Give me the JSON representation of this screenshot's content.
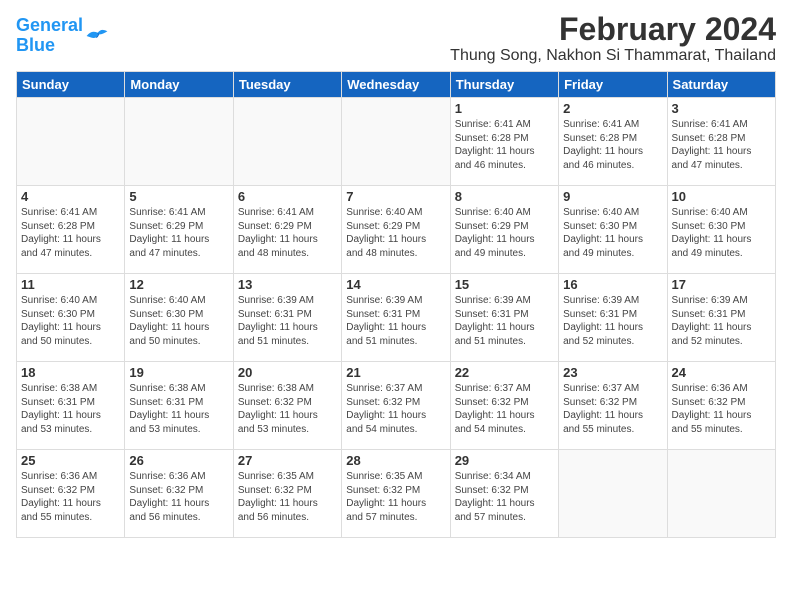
{
  "logo": {
    "line1": "General",
    "line2": "Blue"
  },
  "title": "February 2024",
  "subtitle": "Thung Song, Nakhon Si Thammarat, Thailand",
  "headers": [
    "Sunday",
    "Monday",
    "Tuesday",
    "Wednesday",
    "Thursday",
    "Friday",
    "Saturday"
  ],
  "weeks": [
    [
      {
        "day": "",
        "info": ""
      },
      {
        "day": "",
        "info": ""
      },
      {
        "day": "",
        "info": ""
      },
      {
        "day": "",
        "info": ""
      },
      {
        "day": "1",
        "info": "Sunrise: 6:41 AM\nSunset: 6:28 PM\nDaylight: 11 hours\nand 46 minutes."
      },
      {
        "day": "2",
        "info": "Sunrise: 6:41 AM\nSunset: 6:28 PM\nDaylight: 11 hours\nand 46 minutes."
      },
      {
        "day": "3",
        "info": "Sunrise: 6:41 AM\nSunset: 6:28 PM\nDaylight: 11 hours\nand 47 minutes."
      }
    ],
    [
      {
        "day": "4",
        "info": "Sunrise: 6:41 AM\nSunset: 6:28 PM\nDaylight: 11 hours\nand 47 minutes."
      },
      {
        "day": "5",
        "info": "Sunrise: 6:41 AM\nSunset: 6:29 PM\nDaylight: 11 hours\nand 47 minutes."
      },
      {
        "day": "6",
        "info": "Sunrise: 6:41 AM\nSunset: 6:29 PM\nDaylight: 11 hours\nand 48 minutes."
      },
      {
        "day": "7",
        "info": "Sunrise: 6:40 AM\nSunset: 6:29 PM\nDaylight: 11 hours\nand 48 minutes."
      },
      {
        "day": "8",
        "info": "Sunrise: 6:40 AM\nSunset: 6:29 PM\nDaylight: 11 hours\nand 49 minutes."
      },
      {
        "day": "9",
        "info": "Sunrise: 6:40 AM\nSunset: 6:30 PM\nDaylight: 11 hours\nand 49 minutes."
      },
      {
        "day": "10",
        "info": "Sunrise: 6:40 AM\nSunset: 6:30 PM\nDaylight: 11 hours\nand 49 minutes."
      }
    ],
    [
      {
        "day": "11",
        "info": "Sunrise: 6:40 AM\nSunset: 6:30 PM\nDaylight: 11 hours\nand 50 minutes."
      },
      {
        "day": "12",
        "info": "Sunrise: 6:40 AM\nSunset: 6:30 PM\nDaylight: 11 hours\nand 50 minutes."
      },
      {
        "day": "13",
        "info": "Sunrise: 6:39 AM\nSunset: 6:31 PM\nDaylight: 11 hours\nand 51 minutes."
      },
      {
        "day": "14",
        "info": "Sunrise: 6:39 AM\nSunset: 6:31 PM\nDaylight: 11 hours\nand 51 minutes."
      },
      {
        "day": "15",
        "info": "Sunrise: 6:39 AM\nSunset: 6:31 PM\nDaylight: 11 hours\nand 51 minutes."
      },
      {
        "day": "16",
        "info": "Sunrise: 6:39 AM\nSunset: 6:31 PM\nDaylight: 11 hours\nand 52 minutes."
      },
      {
        "day": "17",
        "info": "Sunrise: 6:39 AM\nSunset: 6:31 PM\nDaylight: 11 hours\nand 52 minutes."
      }
    ],
    [
      {
        "day": "18",
        "info": "Sunrise: 6:38 AM\nSunset: 6:31 PM\nDaylight: 11 hours\nand 53 minutes."
      },
      {
        "day": "19",
        "info": "Sunrise: 6:38 AM\nSunset: 6:31 PM\nDaylight: 11 hours\nand 53 minutes."
      },
      {
        "day": "20",
        "info": "Sunrise: 6:38 AM\nSunset: 6:32 PM\nDaylight: 11 hours\nand 53 minutes."
      },
      {
        "day": "21",
        "info": "Sunrise: 6:37 AM\nSunset: 6:32 PM\nDaylight: 11 hours\nand 54 minutes."
      },
      {
        "day": "22",
        "info": "Sunrise: 6:37 AM\nSunset: 6:32 PM\nDaylight: 11 hours\nand 54 minutes."
      },
      {
        "day": "23",
        "info": "Sunrise: 6:37 AM\nSunset: 6:32 PM\nDaylight: 11 hours\nand 55 minutes."
      },
      {
        "day": "24",
        "info": "Sunrise: 6:36 AM\nSunset: 6:32 PM\nDaylight: 11 hours\nand 55 minutes."
      }
    ],
    [
      {
        "day": "25",
        "info": "Sunrise: 6:36 AM\nSunset: 6:32 PM\nDaylight: 11 hours\nand 55 minutes."
      },
      {
        "day": "26",
        "info": "Sunrise: 6:36 AM\nSunset: 6:32 PM\nDaylight: 11 hours\nand 56 minutes."
      },
      {
        "day": "27",
        "info": "Sunrise: 6:35 AM\nSunset: 6:32 PM\nDaylight: 11 hours\nand 56 minutes."
      },
      {
        "day": "28",
        "info": "Sunrise: 6:35 AM\nSunset: 6:32 PM\nDaylight: 11 hours\nand 57 minutes."
      },
      {
        "day": "29",
        "info": "Sunrise: 6:34 AM\nSunset: 6:32 PM\nDaylight: 11 hours\nand 57 minutes."
      },
      {
        "day": "",
        "info": ""
      },
      {
        "day": "",
        "info": ""
      }
    ]
  ]
}
